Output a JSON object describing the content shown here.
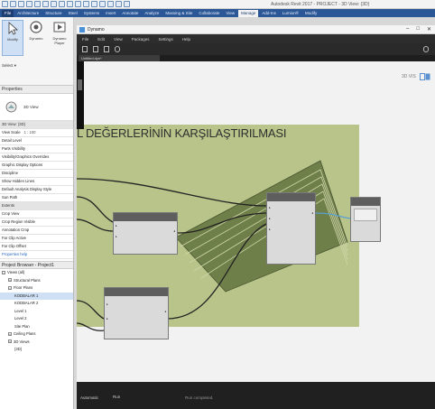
{
  "revit": {
    "title_text": "Autodesk Revit 2017 - PROJECT - 3D View: {3D}",
    "tabs": [
      {
        "label": "File",
        "kind": "file"
      },
      {
        "label": "Architecture",
        "kind": ""
      },
      {
        "label": "Structure",
        "kind": ""
      },
      {
        "label": "Steel",
        "kind": ""
      },
      {
        "label": "Systems",
        "kind": ""
      },
      {
        "label": "Insert",
        "kind": ""
      },
      {
        "label": "Annotate",
        "kind": ""
      },
      {
        "label": "Analyze",
        "kind": ""
      },
      {
        "label": "Massing & Site",
        "kind": ""
      },
      {
        "label": "Collaborate",
        "kind": ""
      },
      {
        "label": "View",
        "kind": ""
      },
      {
        "label": "Manage",
        "kind": "active"
      },
      {
        "label": "Add-Ins",
        "kind": ""
      },
      {
        "label": "Lumion®",
        "kind": ""
      },
      {
        "label": "Modify",
        "kind": ""
      }
    ],
    "ribbon": {
      "modify_label": "Modify",
      "dynamo_label": "Dynamo",
      "player_label": "Dynamo Player",
      "select_label": "Select ▾"
    },
    "properties": {
      "title": "Properties",
      "type_name": "3D View",
      "rows": [
        {
          "label": "3D View: {3D}",
          "value": "",
          "kind": "hdr"
        },
        {
          "label": "View Scale",
          "value": "1 : 100",
          "kind": ""
        },
        {
          "label": "Detail Level",
          "value": "",
          "kind": ""
        },
        {
          "label": "Parts Visibility",
          "value": "",
          "kind": ""
        },
        {
          "label": "Visibility/Graphics Overrides",
          "value": "",
          "kind": ""
        },
        {
          "label": "Graphic Display Options",
          "value": "",
          "kind": ""
        },
        {
          "label": "Discipline",
          "value": "",
          "kind": ""
        },
        {
          "label": "Show Hidden Lines",
          "value": "",
          "kind": ""
        },
        {
          "label": "Default Analysis Display Style",
          "value": "",
          "kind": ""
        },
        {
          "label": "Sun Path",
          "value": "",
          "kind": ""
        },
        {
          "label": "Extents",
          "value": "",
          "kind": "hdr"
        },
        {
          "label": "Crop View",
          "value": "",
          "kind": ""
        },
        {
          "label": "Crop Region Visible",
          "value": "",
          "kind": ""
        },
        {
          "label": "Annotation Crop",
          "value": "",
          "kind": ""
        },
        {
          "label": "Far Clip Active",
          "value": "",
          "kind": ""
        },
        {
          "label": "Far Clip Offset",
          "value": "",
          "kind": ""
        }
      ],
      "help_link": "Properties help"
    },
    "browser": {
      "title": "Project Browser - Project1",
      "items": [
        {
          "label": "Views (all)",
          "depth": 0,
          "toggle": "−",
          "selected": false
        },
        {
          "label": "Structural Plans",
          "depth": 1,
          "toggle": "+",
          "selected": false
        },
        {
          "label": "Floor Plans",
          "depth": 1,
          "toggle": "−",
          "selected": false
        },
        {
          "label": "KODBALAR 1",
          "depth": 2,
          "toggle": "",
          "selected": true
        },
        {
          "label": "KODBALAR 2",
          "depth": 2,
          "toggle": "",
          "selected": false
        },
        {
          "label": "Level 1",
          "depth": 2,
          "toggle": "",
          "selected": false
        },
        {
          "label": "Level 2",
          "depth": 2,
          "toggle": "",
          "selected": false
        },
        {
          "label": "Site Plan",
          "depth": 2,
          "toggle": "",
          "selected": false
        },
        {
          "label": "Ceiling Plans",
          "depth": 1,
          "toggle": "+",
          "selected": false
        },
        {
          "label": "3D Views",
          "depth": 1,
          "toggle": "+",
          "selected": false
        },
        {
          "label": "{3D}",
          "depth": 2,
          "toggle": "",
          "selected": false
        }
      ]
    }
  },
  "dynamo": {
    "title": "Dynamo",
    "menu": [
      "File",
      "Edit",
      "View",
      "Packages",
      "Settings",
      "Help"
    ],
    "tab_label": "Untitled.dyn*",
    "zoom_text": "3D VIS",
    "group_title": "L DEĞERLERİNİN KARŞILAŞTIRILMASI",
    "run_mode": "Automatic",
    "run_label": "Run",
    "status_message": "Run completed."
  }
}
